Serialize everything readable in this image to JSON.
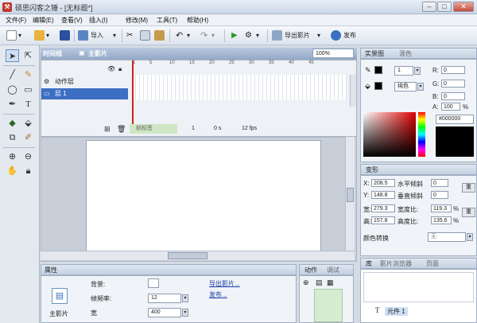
{
  "window": {
    "title": "硕思闪客之锤 - [无标题*]",
    "min": "–",
    "max": "□",
    "close": "✕"
  },
  "menu": [
    "文件(F)",
    "编辑(E)",
    "查看(V)",
    "插入(I)",
    "修改(M)",
    "工具(T)",
    "帮助(H)"
  ],
  "toolbar": {
    "import_label": "导入",
    "export_movie_label": "导出影片",
    "publish_label": "发布"
  },
  "timeline": {
    "tab_label": "时间线",
    "scene_label": "主影片",
    "zoom": "100%",
    "layers": [
      {
        "name": "动作层",
        "type": "folder"
      },
      {
        "name": "层 1",
        "type": "layer"
      }
    ],
    "ruler": [
      "1",
      "5",
      "10",
      "15",
      "20",
      "25",
      "30",
      "35",
      "40",
      "45"
    ],
    "status": {
      "label": "帧标签",
      "frame": "1",
      "time": "0 s",
      "fps": "12 fps"
    }
  },
  "properties": {
    "tab_label": "属性",
    "type_label": "主影片",
    "background_label": "背景:",
    "framerate_label": "帧频率:",
    "framerate_value": "12",
    "width_label": "宽",
    "width_value": "400",
    "export_link": "导出影片...",
    "publish_link": "发布..."
  },
  "actions": {
    "tab1": "动作",
    "tab2": "调试"
  },
  "color_panel": {
    "tabs": [
      "实景图",
      "混色"
    ],
    "stroke_width": "1",
    "fill_type": "纯色",
    "r": "0",
    "g": "0",
    "b": "0",
    "alpha_label": "A:",
    "alpha_value": "100",
    "alpha_unit": "%",
    "hex": "#000000",
    "r_label": "R:",
    "g_label": "G:",
    "b_label": "B:"
  },
  "transform_panel": {
    "title": "变形",
    "x_label": "X:",
    "x_value": "208.5",
    "y_label": "Y:",
    "y_value": "148.8",
    "w_label": "宽:",
    "w_value": "279.3",
    "h_label": "高:",
    "h_value": "157.8",
    "skew_h_label": "水平倾斜",
    "skew_h_value": "0",
    "skew_v_label": "垂直倾斜",
    "skew_v_value": "0",
    "scale_w_label": "宽度比:",
    "scale_w_value": "119.3",
    "scale_h_label": "高度比:",
    "scale_h_value": "135.6",
    "percent": "%",
    "reset_label": "重",
    "color_transform_label": "颜色转换",
    "color_transform_value": "无"
  },
  "library_panel": {
    "tabs": [
      "库",
      "影片浏览器",
      "页面"
    ],
    "item": "元件 1"
  },
  "colors": {
    "selection_blue": "#6a8fc0",
    "accent_red": "#cc2222",
    "green_play": "#2a9a2a"
  }
}
